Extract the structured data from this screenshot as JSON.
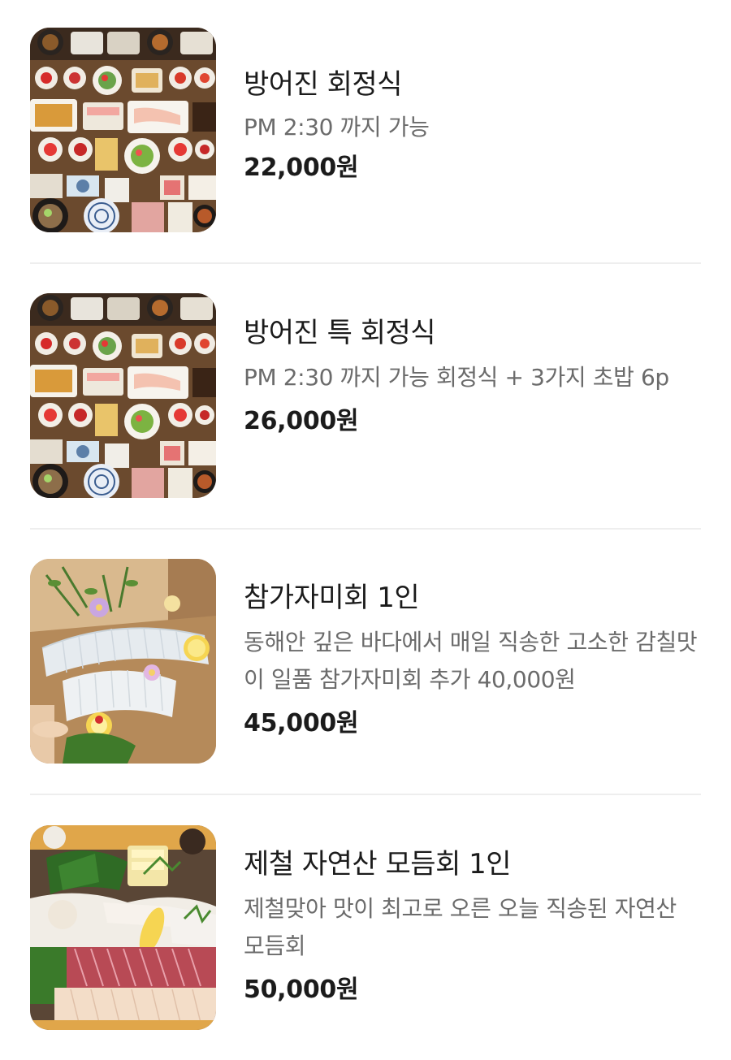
{
  "menu": {
    "items": [
      {
        "name": "방어진 회정식",
        "description": "PM 2:30 까지 가능",
        "price": "22,000원",
        "image_icon": "sashimi-set-meal-photo"
      },
      {
        "name": "방어진 특 회정식",
        "description": "PM 2:30 까지 가능 회정식 + 3가지 초밥 6p",
        "price": "26,000원",
        "image_icon": "sashimi-set-meal-photo"
      },
      {
        "name": "참가자미회 1인",
        "description": "동해안 깊은 바다에서 매일 직송한 고소한 감칠맛이 일품 참가자미회 추가 40,000원",
        "price": "45,000원",
        "image_icon": "flounder-sashimi-platter-photo"
      },
      {
        "name": "제철 자연산 모듬회 1인",
        "description": "제철맞아 맛이 최고로 오른 오늘 직송된 자연산 모듬회",
        "price": "50,000원",
        "image_icon": "assorted-sashimi-platter-photo"
      }
    ]
  }
}
